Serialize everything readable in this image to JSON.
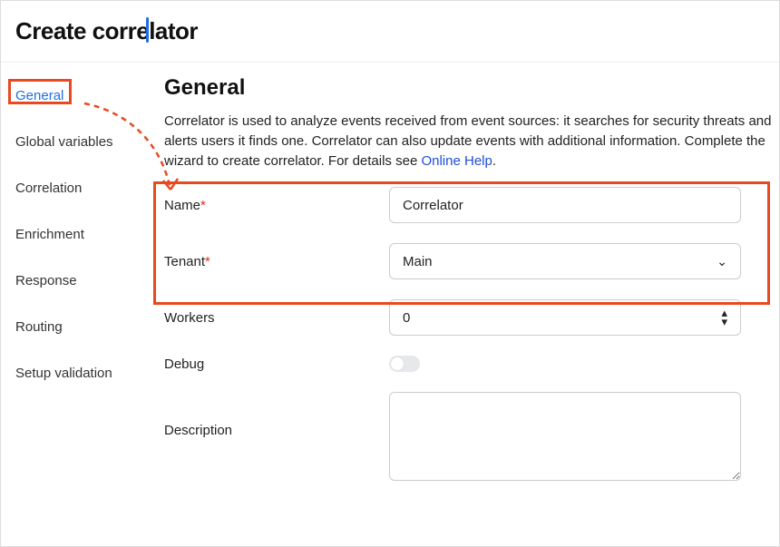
{
  "header": {
    "title": "Create correlator"
  },
  "sidebar": {
    "items": [
      {
        "label": "General",
        "active": true
      },
      {
        "label": "Global variables"
      },
      {
        "label": "Correlation"
      },
      {
        "label": "Enrichment"
      },
      {
        "label": "Response"
      },
      {
        "label": "Routing"
      },
      {
        "label": "Setup validation"
      }
    ]
  },
  "main": {
    "heading": "General",
    "description": "Correlator is used to analyze events received from event sources: it searches for security threats and alerts users it finds one. Correlator can also update events with additional information. Complete the wizard to create correlator. For details see ",
    "help_link": "Online Help",
    "fields": {
      "name_label": "Name",
      "name_value": "Correlator",
      "tenant_label": "Tenant",
      "tenant_value": "Main",
      "workers_label": "Workers",
      "workers_value": "0",
      "debug_label": "Debug",
      "debug_value": false,
      "description_label": "Description",
      "description_value": ""
    }
  },
  "annotation": {
    "color": "#e84a1f"
  }
}
